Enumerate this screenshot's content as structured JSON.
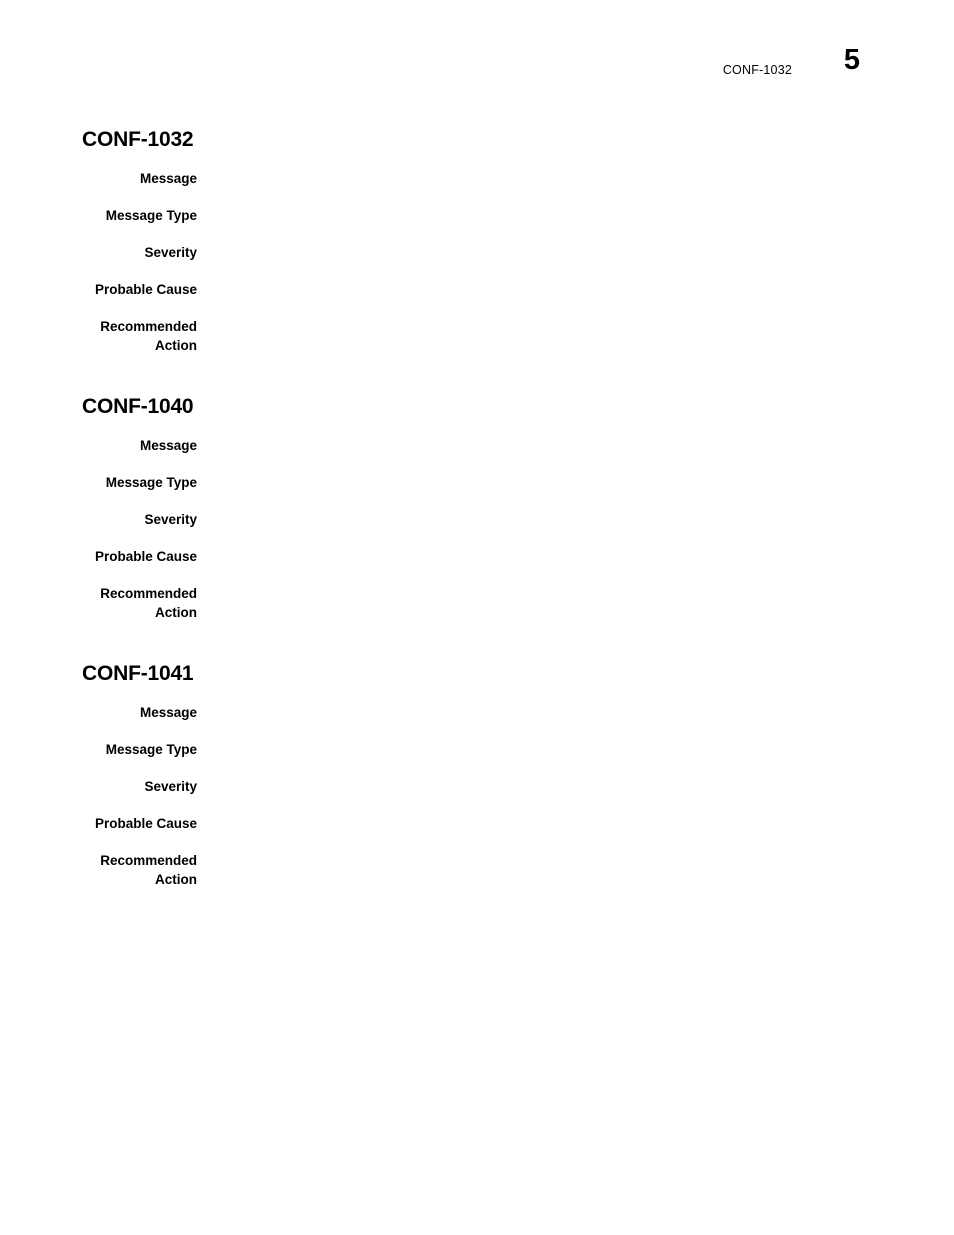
{
  "document": {
    "header": {
      "running_reference": "CONF-1032",
      "page_number": "5"
    }
  },
  "sections": [
    {
      "heading": "CONF-1032",
      "fields": [
        {
          "label": "Message",
          "value": ""
        },
        {
          "label": "Message Type",
          "value": ""
        },
        {
          "label": "Severity",
          "value": ""
        },
        {
          "label": "Probable Cause",
          "value": ""
        },
        {
          "label": "Recommended Action",
          "value": ""
        }
      ]
    },
    {
      "heading": "CONF-1040",
      "fields": [
        {
          "label": "Message",
          "value": ""
        },
        {
          "label": "Message Type",
          "value": ""
        },
        {
          "label": "Severity",
          "value": ""
        },
        {
          "label": "Probable Cause",
          "value": ""
        },
        {
          "label": "Recommended Action",
          "value": ""
        }
      ]
    },
    {
      "heading": "CONF-1041",
      "fields": [
        {
          "label": "Message",
          "value": ""
        },
        {
          "label": "Message Type",
          "value": ""
        },
        {
          "label": "Severity",
          "value": ""
        },
        {
          "label": "Probable Cause",
          "value": ""
        },
        {
          "label": "Recommended Action",
          "value": ""
        }
      ]
    }
  ]
}
